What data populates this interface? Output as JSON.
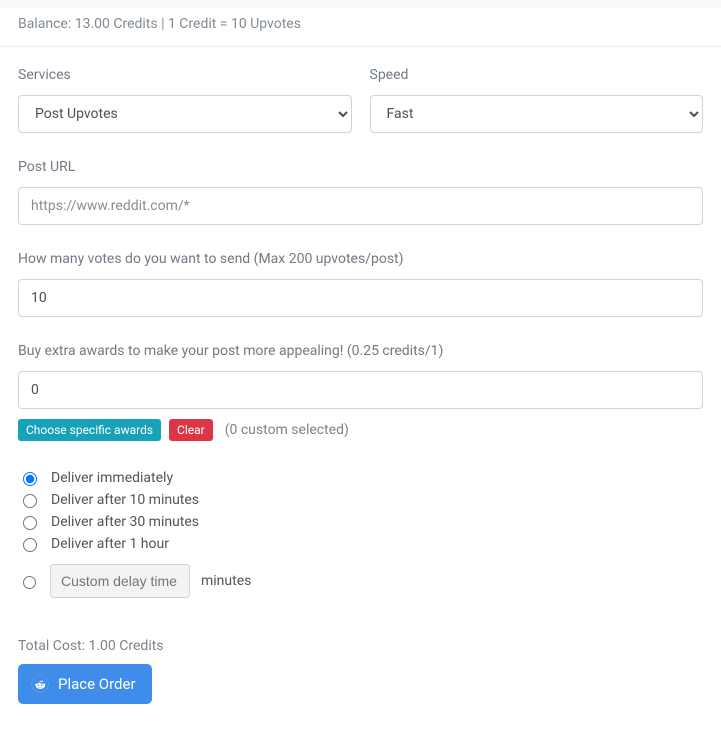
{
  "balance_text": "Balance: 13.00 Credits | 1 Credit = 10 Upvotes",
  "services": {
    "label": "Services",
    "selected": "Post Upvotes"
  },
  "speed": {
    "label": "Speed",
    "selected": "Fast"
  },
  "post_url": {
    "label": "Post URL",
    "placeholder": "https://www.reddit.com/*",
    "value": ""
  },
  "votes": {
    "label": "How many votes do you want to send (Max 200 upvotes/post)",
    "value": "10"
  },
  "awards": {
    "label": "Buy extra awards to make your post more appealing! (0.25 credits/1)",
    "value": "0",
    "choose_label": "Choose specific awards",
    "clear_label": "Clear",
    "selected_text": "(0 custom selected)"
  },
  "delivery": {
    "options": [
      "Deliver immediately",
      "Deliver after 10 minutes",
      "Deliver after 30 minutes",
      "Deliver after 1 hour"
    ],
    "selected_index": 0,
    "custom_placeholder": "Custom delay time",
    "custom_suffix": "minutes"
  },
  "total_cost": "Total Cost: 1.00 Credits",
  "place_order_label": "Place Order"
}
